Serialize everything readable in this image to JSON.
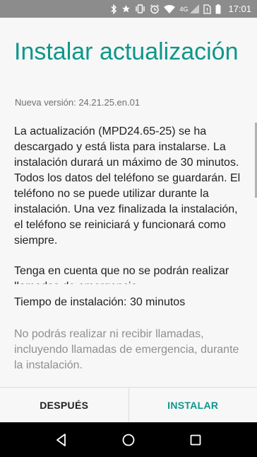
{
  "status_bar": {
    "network_label": "4G",
    "time": "17:01",
    "icons": [
      "bluetooth-icon",
      "star-icon",
      "vibrate-icon",
      "alarm-icon",
      "wifi-icon",
      "signal-icon",
      "no-sim-icon",
      "battery-icon"
    ]
  },
  "dialog": {
    "title": "Instalar actualización",
    "version": "Nueva versión: 24.21.25.en.01",
    "paragraphs": [
      "La actualización (MPD24.65-25) se ha descargado y está lista para instalarse. La instalación durará un máximo de 30 minutos. Todos los datos del teléfono se guardarán. El teléfono no se puede utilizar durante la instalación. Una vez finalizada la instalación, el teléfono se reiniciará y funcionará como siempre.",
      "Tenga en cuenta que no se podrán realizar llamadas de emergencia"
    ],
    "install_time": "Tiempo de instalación: 30 minutos",
    "note": "No podrás realizar ni recibir llamadas, incluyendo llamadas de emergencia, durante la instalación.",
    "later_label": "DESPUÉS",
    "install_label": "INSTALAR"
  },
  "navigation": {
    "icons": [
      "back-icon",
      "home-icon",
      "recents-icon"
    ]
  },
  "colors": {
    "accent": "#0f968a",
    "status_bar": "#8c8c8c",
    "background": "#f7f7f7"
  }
}
